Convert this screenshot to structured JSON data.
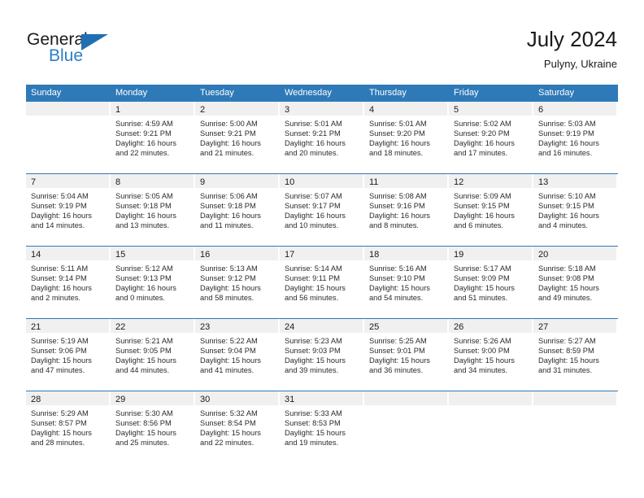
{
  "brand": {
    "name_part1": "General",
    "name_part2": "Blue",
    "accent_color": "#2a7fc9",
    "triangle_color": "#1f6fb5"
  },
  "header": {
    "title": "July 2024",
    "subtitle": "Pulyny, Ukraine"
  },
  "calendar": {
    "header_bg": "#2e7ab8",
    "weekdays": [
      "Sunday",
      "Monday",
      "Tuesday",
      "Wednesday",
      "Thursday",
      "Friday",
      "Saturday"
    ],
    "weeks": [
      [
        {
          "day": "",
          "lines": []
        },
        {
          "day": "1",
          "lines": [
            "Sunrise: 4:59 AM",
            "Sunset: 9:21 PM",
            "Daylight: 16 hours",
            "and 22 minutes."
          ]
        },
        {
          "day": "2",
          "lines": [
            "Sunrise: 5:00 AM",
            "Sunset: 9:21 PM",
            "Daylight: 16 hours",
            "and 21 minutes."
          ]
        },
        {
          "day": "3",
          "lines": [
            "Sunrise: 5:01 AM",
            "Sunset: 9:21 PM",
            "Daylight: 16 hours",
            "and 20 minutes."
          ]
        },
        {
          "day": "4",
          "lines": [
            "Sunrise: 5:01 AM",
            "Sunset: 9:20 PM",
            "Daylight: 16 hours",
            "and 18 minutes."
          ]
        },
        {
          "day": "5",
          "lines": [
            "Sunrise: 5:02 AM",
            "Sunset: 9:20 PM",
            "Daylight: 16 hours",
            "and 17 minutes."
          ]
        },
        {
          "day": "6",
          "lines": [
            "Sunrise: 5:03 AM",
            "Sunset: 9:19 PM",
            "Daylight: 16 hours",
            "and 16 minutes."
          ]
        }
      ],
      [
        {
          "day": "7",
          "lines": [
            "Sunrise: 5:04 AM",
            "Sunset: 9:19 PM",
            "Daylight: 16 hours",
            "and 14 minutes."
          ]
        },
        {
          "day": "8",
          "lines": [
            "Sunrise: 5:05 AM",
            "Sunset: 9:18 PM",
            "Daylight: 16 hours",
            "and 13 minutes."
          ]
        },
        {
          "day": "9",
          "lines": [
            "Sunrise: 5:06 AM",
            "Sunset: 9:18 PM",
            "Daylight: 16 hours",
            "and 11 minutes."
          ]
        },
        {
          "day": "10",
          "lines": [
            "Sunrise: 5:07 AM",
            "Sunset: 9:17 PM",
            "Daylight: 16 hours",
            "and 10 minutes."
          ]
        },
        {
          "day": "11",
          "lines": [
            "Sunrise: 5:08 AM",
            "Sunset: 9:16 PM",
            "Daylight: 16 hours",
            "and 8 minutes."
          ]
        },
        {
          "day": "12",
          "lines": [
            "Sunrise: 5:09 AM",
            "Sunset: 9:15 PM",
            "Daylight: 16 hours",
            "and 6 minutes."
          ]
        },
        {
          "day": "13",
          "lines": [
            "Sunrise: 5:10 AM",
            "Sunset: 9:15 PM",
            "Daylight: 16 hours",
            "and 4 minutes."
          ]
        }
      ],
      [
        {
          "day": "14",
          "lines": [
            "Sunrise: 5:11 AM",
            "Sunset: 9:14 PM",
            "Daylight: 16 hours",
            "and 2 minutes."
          ]
        },
        {
          "day": "15",
          "lines": [
            "Sunrise: 5:12 AM",
            "Sunset: 9:13 PM",
            "Daylight: 16 hours",
            "and 0 minutes."
          ]
        },
        {
          "day": "16",
          "lines": [
            "Sunrise: 5:13 AM",
            "Sunset: 9:12 PM",
            "Daylight: 15 hours",
            "and 58 minutes."
          ]
        },
        {
          "day": "17",
          "lines": [
            "Sunrise: 5:14 AM",
            "Sunset: 9:11 PM",
            "Daylight: 15 hours",
            "and 56 minutes."
          ]
        },
        {
          "day": "18",
          "lines": [
            "Sunrise: 5:16 AM",
            "Sunset: 9:10 PM",
            "Daylight: 15 hours",
            "and 54 minutes."
          ]
        },
        {
          "day": "19",
          "lines": [
            "Sunrise: 5:17 AM",
            "Sunset: 9:09 PM",
            "Daylight: 15 hours",
            "and 51 minutes."
          ]
        },
        {
          "day": "20",
          "lines": [
            "Sunrise: 5:18 AM",
            "Sunset: 9:08 PM",
            "Daylight: 15 hours",
            "and 49 minutes."
          ]
        }
      ],
      [
        {
          "day": "21",
          "lines": [
            "Sunrise: 5:19 AM",
            "Sunset: 9:06 PM",
            "Daylight: 15 hours",
            "and 47 minutes."
          ]
        },
        {
          "day": "22",
          "lines": [
            "Sunrise: 5:21 AM",
            "Sunset: 9:05 PM",
            "Daylight: 15 hours",
            "and 44 minutes."
          ]
        },
        {
          "day": "23",
          "lines": [
            "Sunrise: 5:22 AM",
            "Sunset: 9:04 PM",
            "Daylight: 15 hours",
            "and 41 minutes."
          ]
        },
        {
          "day": "24",
          "lines": [
            "Sunrise: 5:23 AM",
            "Sunset: 9:03 PM",
            "Daylight: 15 hours",
            "and 39 minutes."
          ]
        },
        {
          "day": "25",
          "lines": [
            "Sunrise: 5:25 AM",
            "Sunset: 9:01 PM",
            "Daylight: 15 hours",
            "and 36 minutes."
          ]
        },
        {
          "day": "26",
          "lines": [
            "Sunrise: 5:26 AM",
            "Sunset: 9:00 PM",
            "Daylight: 15 hours",
            "and 34 minutes."
          ]
        },
        {
          "day": "27",
          "lines": [
            "Sunrise: 5:27 AM",
            "Sunset: 8:59 PM",
            "Daylight: 15 hours",
            "and 31 minutes."
          ]
        }
      ],
      [
        {
          "day": "28",
          "lines": [
            "Sunrise: 5:29 AM",
            "Sunset: 8:57 PM",
            "Daylight: 15 hours",
            "and 28 minutes."
          ]
        },
        {
          "day": "29",
          "lines": [
            "Sunrise: 5:30 AM",
            "Sunset: 8:56 PM",
            "Daylight: 15 hours",
            "and 25 minutes."
          ]
        },
        {
          "day": "30",
          "lines": [
            "Sunrise: 5:32 AM",
            "Sunset: 8:54 PM",
            "Daylight: 15 hours",
            "and 22 minutes."
          ]
        },
        {
          "day": "31",
          "lines": [
            "Sunrise: 5:33 AM",
            "Sunset: 8:53 PM",
            "Daylight: 15 hours",
            "and 19 minutes."
          ]
        },
        {
          "day": "",
          "lines": []
        },
        {
          "day": "",
          "lines": []
        },
        {
          "day": "",
          "lines": []
        }
      ]
    ]
  }
}
